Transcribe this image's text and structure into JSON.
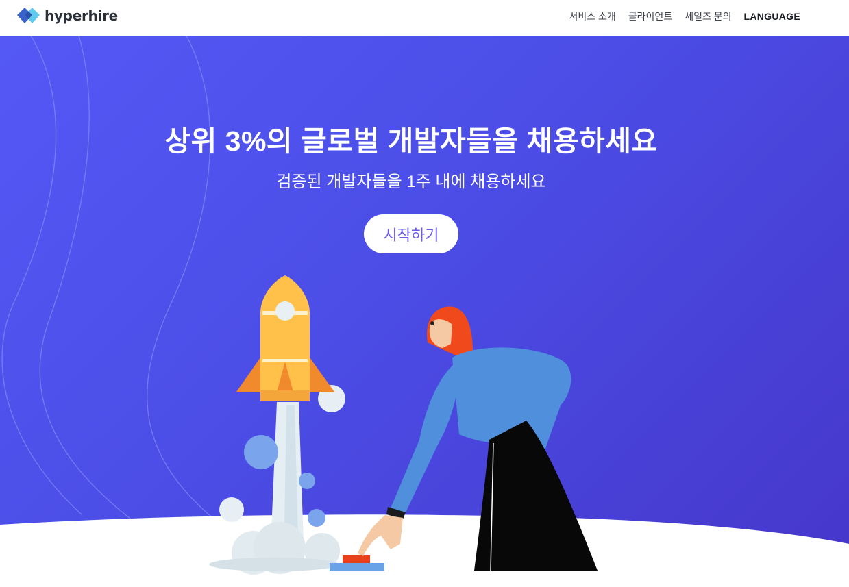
{
  "header": {
    "logo_text": "hyperhire",
    "nav": [
      {
        "label": "서비스 소개"
      },
      {
        "label": "클라이언트"
      },
      {
        "label": "세일즈 문의"
      },
      {
        "label": "LANGUAGE"
      }
    ]
  },
  "hero": {
    "title": "상위 3%의 글로벌 개발자들을 채용하세요",
    "subtitle": "검증된 개발자들을 1주 내에 채용하세요",
    "cta_label": "시작하기",
    "illustration": {
      "rocket": "rocket-launch",
      "person": "woman-pressing-launch-button"
    }
  },
  "colors": {
    "hero_gradient_start": "#5558f5",
    "hero_gradient_end": "#4636c9",
    "cta_text": "#6b5df0",
    "logo_blue": "#3a6fd8",
    "logo_cyan": "#53c6ea"
  }
}
